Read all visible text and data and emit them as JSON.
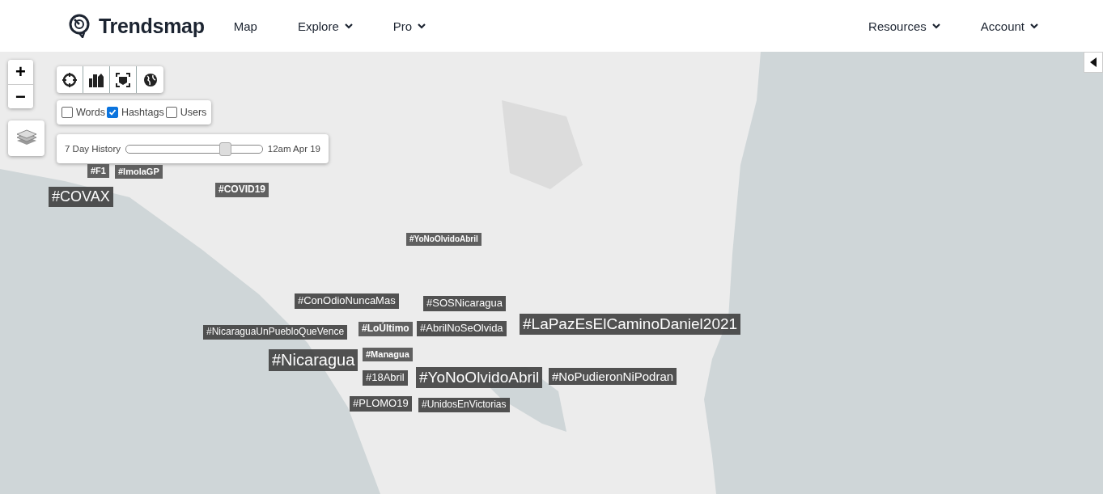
{
  "header": {
    "logo": "Trendsmap",
    "nav": [
      {
        "label": "Map",
        "dropdown": false
      },
      {
        "label": "Explore",
        "dropdown": true
      },
      {
        "label": "Pro",
        "dropdown": true
      }
    ],
    "nav_right": [
      {
        "label": "Resources",
        "dropdown": true
      },
      {
        "label": "Account",
        "dropdown": true
      }
    ]
  },
  "zoom": {
    "plus": "+",
    "minus": "−"
  },
  "filters": [
    {
      "label": "Words",
      "checked": false
    },
    {
      "label": "Hashtags",
      "checked": true
    },
    {
      "label": "Users",
      "checked": false
    }
  ],
  "history": {
    "label": "7 Day History",
    "level": 0.73,
    "reading": "12am Apr 19"
  },
  "tags": [
    {
      "text": "#F1"
    },
    {
      "text": "#ImolaGP"
    },
    {
      "text": "#COVAX"
    },
    {
      "text": "#COVID19"
    },
    {
      "text": "#YoNoOlvidoAbril"
    },
    {
      "text": "#ConOdioNuncaMas"
    },
    {
      "text": "#SOSNicaragua"
    },
    {
      "text": "#NicaraguaUnPuebloQueVence"
    },
    {
      "text": "#LoÚltimo"
    },
    {
      "text": "#AbrilNoSeOlvida"
    },
    {
      "text": "#LaPazEsElCaminoDaniel2021"
    },
    {
      "text": "#Nicaragua"
    },
    {
      "text": "#Managua"
    },
    {
      "text": "#18Abril"
    },
    {
      "text": "#YoNoOlvidoAbril"
    },
    {
      "text": "#NoPudieronNiPodran"
    },
    {
      "text": "#PLOMO19"
    },
    {
      "text": "#UnidosEnVictorias"
    }
  ]
}
